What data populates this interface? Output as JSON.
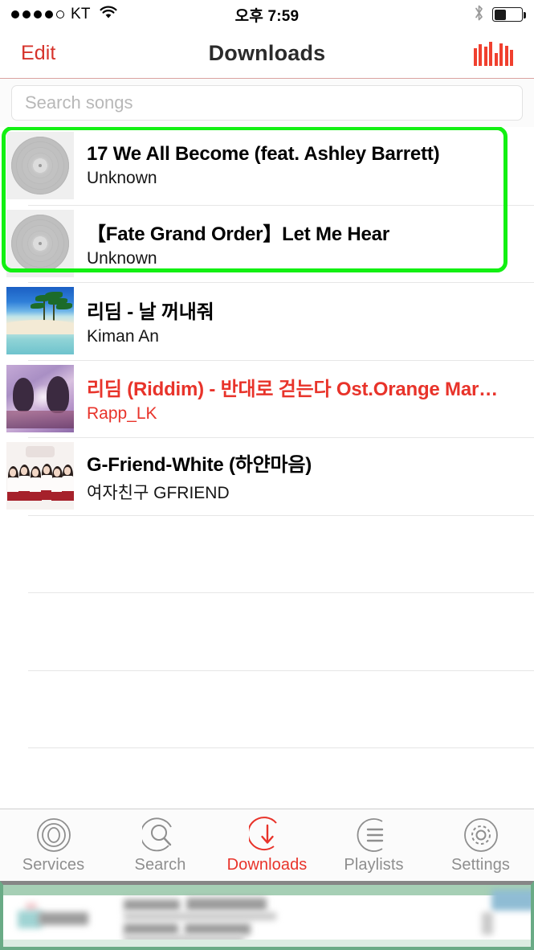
{
  "status_bar": {
    "signal_dots_filled": 4,
    "signal_dots_total": 5,
    "carrier": "KT",
    "wifi_icon": "wifi-icon",
    "time": "오후 7:59",
    "bluetooth_icon": "bluetooth-icon",
    "battery_percent": 40
  },
  "nav_bar": {
    "edit_label": "Edit",
    "title": "Downloads",
    "now_playing_icon": "equalizer-icon",
    "edit_color": "#d6332b",
    "accent_color": "#e8332a"
  },
  "search": {
    "value": "",
    "placeholder": "Search songs"
  },
  "songs": [
    {
      "title": "17 We All Become (feat. Ashley Barrett)",
      "artist": "Unknown",
      "artwork": "vinyl-placeholder",
      "playing": false,
      "highlighted": true
    },
    {
      "title": "【Fate Grand Order】Let Me Hear",
      "artist": "Unknown",
      "artwork": "vinyl-placeholder",
      "playing": false,
      "highlighted": true
    },
    {
      "title": "리딤 - 날 꺼내줘",
      "artist": "Kiman An",
      "artwork": "beach-artwork",
      "playing": false,
      "highlighted": false
    },
    {
      "title": "리딤 (Riddim) - 반대로 걷는다 Ost.Orange Mar…",
      "artist": "Rapp_LK",
      "artwork": "anime-artwork",
      "playing": true,
      "highlighted": false
    },
    {
      "title": "G-Friend-White (하얀마음)",
      "artist": "여자친구 GFRIEND",
      "artwork": "gfriend-artwork",
      "playing": false,
      "highlighted": false
    }
  ],
  "empty_rows": 4,
  "highlight": {
    "color": "#12f012",
    "covers_rows": [
      0,
      1
    ]
  },
  "tab_bar": {
    "items": [
      {
        "label": "Services",
        "icon": "concentric-circles-icon",
        "active": false
      },
      {
        "label": "Search",
        "icon": "magnifier-circle-icon",
        "active": false
      },
      {
        "label": "Downloads",
        "icon": "download-circle-icon",
        "active": true
      },
      {
        "label": "Playlists",
        "icon": "list-circle-icon",
        "active": false
      },
      {
        "label": "Settings",
        "icon": "gear-circle-icon",
        "active": false
      }
    ]
  },
  "bottom_overlay": {
    "type": "blurred-redacted-region",
    "border_color": "#6aab86"
  }
}
